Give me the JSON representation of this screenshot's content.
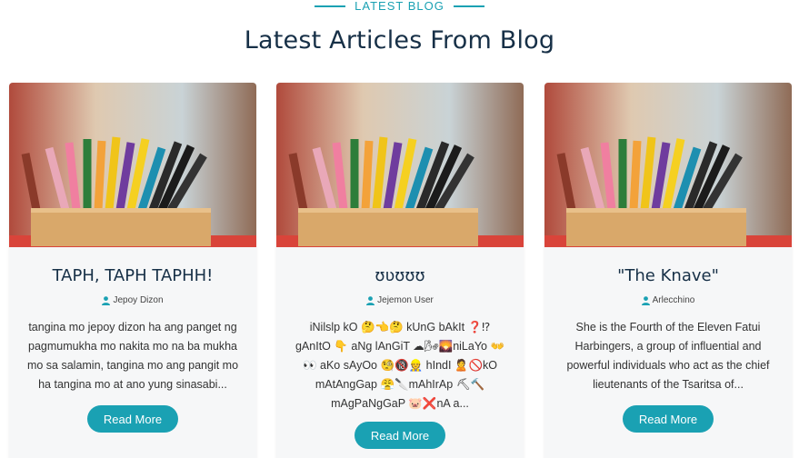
{
  "section": {
    "eyebrow": "LATEST BLOG",
    "heading": "Latest Articles From Blog"
  },
  "cards": [
    {
      "title": "TAPH, TAPH TAPHH!",
      "author": "Jepoy Dizon",
      "excerpt": "tangina mo jepoy dizon ha ang panget ng pagmumukha mo nakita mo na ba mukha mo sa salamin, tangina mo ang pangit mo ha tangina mo at ano yung sinasabi...",
      "button": "Read More"
    },
    {
      "title": "ʊʋʊʊʊ",
      "author": "Jejemon User",
      "excerpt": "iNilslp kO 🤔👈🤔 kUnG bAkIt ❓⁉ gAnItO 👇 aNg lAnGiT ☁🌬🌄niLaYo 👐 👀 aKo sAyOo 🧐🔞👷 hIndI 🙎🚫kO mAtAngGap 😤🔪mAhIrAp ⛏🔨 mAgPaNgGaP 🐷❌nA a...",
      "button": "Read More"
    },
    {
      "title": "\"The Knave\"",
      "author": "Arlecchino",
      "excerpt": "She is the Fourth of the Eleven Fatui Harbingers, a group of influential and powerful individuals who act as the chief lieutenants of the Tsaritsa of...",
      "button": "Read More"
    }
  ],
  "icons": {
    "author": "user-icon"
  },
  "colors": {
    "accent": "#1aa1b3",
    "heading": "#173047",
    "card_bg": "#f6f7f8"
  }
}
